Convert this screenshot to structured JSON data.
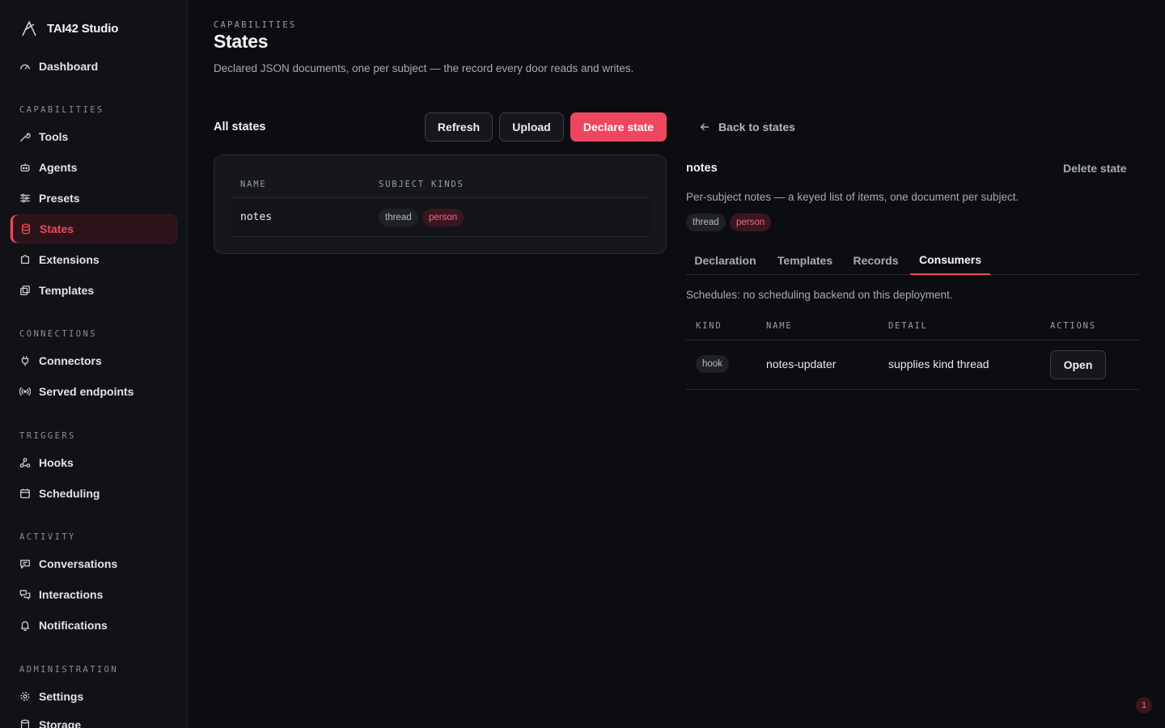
{
  "app": {
    "name": "TAI42 Studio"
  },
  "sidebar": {
    "dashboard": {
      "label": "Dashboard"
    },
    "sections": [
      {
        "label": "CAPABILITIES",
        "items": [
          {
            "label": "Tools"
          },
          {
            "label": "Agents"
          },
          {
            "label": "Presets"
          },
          {
            "label": "States"
          },
          {
            "label": "Extensions"
          },
          {
            "label": "Templates"
          }
        ]
      },
      {
        "label": "CONNECTIONS",
        "items": [
          {
            "label": "Connectors"
          },
          {
            "label": "Served endpoints"
          }
        ]
      },
      {
        "label": "TRIGGERS",
        "items": [
          {
            "label": "Hooks"
          },
          {
            "label": "Scheduling"
          }
        ]
      },
      {
        "label": "ACTIVITY",
        "items": [
          {
            "label": "Conversations"
          },
          {
            "label": "Interactions"
          },
          {
            "label": "Notifications"
          }
        ]
      },
      {
        "label": "ADMINISTRATION",
        "items": [
          {
            "label": "Settings"
          },
          {
            "label": "Storage"
          }
        ]
      }
    ],
    "active_item": "States"
  },
  "page": {
    "eyebrow": "CAPABILITIES",
    "title": "States",
    "description": "Declared JSON documents, one per subject — the record every door reads and writes."
  },
  "list": {
    "title": "All states",
    "buttons": {
      "refresh": "Refresh",
      "upload": "Upload",
      "declare": "Declare state"
    },
    "columns": {
      "name": "NAME",
      "subject_kinds": "SUBJECT KINDS"
    },
    "rows": [
      {
        "name": "notes",
        "kinds": [
          "thread",
          "person"
        ]
      }
    ]
  },
  "detail": {
    "back_label": "Back to states",
    "title": "notes",
    "delete_label": "Delete state",
    "description": "Per-subject notes — a keyed list of items, one document per subject.",
    "kinds": [
      "thread",
      "person"
    ],
    "tabs": [
      "Declaration",
      "Templates",
      "Records",
      "Consumers"
    ],
    "active_tab": "Consumers",
    "schedules_note": "Schedules: no scheduling backend on this deployment.",
    "consumers": {
      "columns": {
        "kind": "KIND",
        "name": "NAME",
        "detail": "DETAIL",
        "actions": "ACTIONS"
      },
      "rows": [
        {
          "kind": "hook",
          "name": "notes-updater",
          "detail": "supplies kind thread",
          "action": "Open"
        }
      ]
    }
  },
  "notifications": {
    "count": "1"
  },
  "colors": {
    "accent": "#ef4660",
    "background": "#0c0d10",
    "sidebar": "#111216"
  }
}
